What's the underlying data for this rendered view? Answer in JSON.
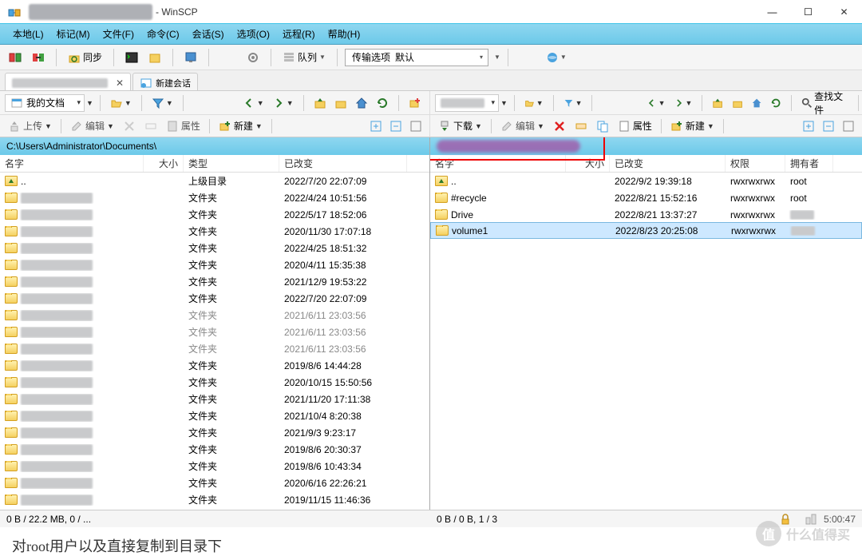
{
  "window": {
    "title_suffix": "- WinSCP",
    "minimize": "—",
    "maximize": "☐",
    "close": "✕"
  },
  "menu": {
    "local": "本地(L)",
    "mark": "标记(M)",
    "files": "文件(F)",
    "commands": "命令(C)",
    "session": "会话(S)",
    "options": "选项(O)",
    "remote": "远程(R)",
    "help": "帮助(H)"
  },
  "toolbar": {
    "sync_label": "同步",
    "queue_label": "队列",
    "transfer_settings_label": "传输选项",
    "transfer_default": "默认"
  },
  "tabs": {
    "new_session": "新建会话"
  },
  "left_panel": {
    "drive_label": "我的文档",
    "upload": "上传",
    "edit": "编辑",
    "props": "属性",
    "new": "新建",
    "path": "C:\\Users\\Administrator\\Documents\\",
    "columns": {
      "name": "名字",
      "size": "大小",
      "type": "类型",
      "changed": "已改变"
    },
    "rows": [
      {
        "name": "..",
        "type": "上级目录",
        "changed": "2022/7/20  22:07:09",
        "up": true
      },
      {
        "name": "",
        "type": "文件夹",
        "changed": "2022/4/24  10:51:56"
      },
      {
        "name": "",
        "type": "文件夹",
        "changed": "2022/5/17  18:52:06"
      },
      {
        "name": "",
        "type": "文件夹",
        "changed": "2020/11/30  17:07:18"
      },
      {
        "name": "",
        "type": "文件夹",
        "changed": "2022/4/25  18:51:32"
      },
      {
        "name": "",
        "type": "文件夹",
        "changed": "2020/4/11  15:35:38"
      },
      {
        "name": "",
        "type": "文件夹",
        "changed": "2021/12/9  19:53:22"
      },
      {
        "name": "",
        "type": "文件夹",
        "changed": "2022/7/20  22:07:09"
      },
      {
        "name": "",
        "type": "文件夹",
        "changed": "2021/6/11  23:03:56",
        "dim": true
      },
      {
        "name": "",
        "type": "文件夹",
        "changed": "2021/6/11  23:03:56",
        "dim": true
      },
      {
        "name": "",
        "type": "文件夹",
        "changed": "2021/6/11  23:03:56",
        "dim": true
      },
      {
        "name": "",
        "type": "文件夹",
        "changed": "2019/8/6  14:44:28"
      },
      {
        "name": "",
        "type": "文件夹",
        "changed": "2020/10/15  15:50:56"
      },
      {
        "name": "",
        "type": "文件夹",
        "changed": "2021/11/20  17:11:38"
      },
      {
        "name": "",
        "type": "文件夹",
        "changed": "2021/10/4  8:20:38"
      },
      {
        "name": "",
        "type": "文件夹",
        "changed": "2021/9/3  9:23:17"
      },
      {
        "name": "",
        "type": "文件夹",
        "changed": "2019/8/6  20:30:37"
      },
      {
        "name": "",
        "type": "文件夹",
        "changed": "2019/8/6  10:43:34"
      },
      {
        "name": "",
        "type": "文件夹",
        "changed": "2020/6/16  22:26:21"
      },
      {
        "name": "",
        "type": "文件夹",
        "changed": "2019/11/15  11:46:36"
      }
    ],
    "status": "0 B / 22.2 MB,  0 / ..."
  },
  "right_panel": {
    "download": "下载",
    "edit": "编辑",
    "props": "属性",
    "new": "新建",
    "find_files": "查找文件",
    "columns": {
      "name": "名字",
      "size": "大小",
      "changed": "已改变",
      "perm": "权限",
      "owner": "拥有者"
    },
    "rows": [
      {
        "name": "..",
        "changed": "2022/9/2 19:39:18",
        "perm": "rwxrwxrwx",
        "owner": "root",
        "up": true
      },
      {
        "name": "#recycle",
        "changed": "2022/8/21 15:52:16",
        "perm": "rwxrwxrwx",
        "owner": "root"
      },
      {
        "name": "Drive",
        "changed": "2022/8/21 13:37:27",
        "perm": "rwxrwxrwx",
        "owner": ""
      },
      {
        "name": "volume1",
        "changed": "2022/8/23 20:25:08",
        "perm": "rwxrwxrwx",
        "owner": "",
        "selected": true
      }
    ],
    "status": "0 B / 0 B,  1 / 3",
    "time": "5:00:47"
  },
  "chinese_caption": "对root用户以及直接复制到目录下",
  "watermark": "什么值得买"
}
